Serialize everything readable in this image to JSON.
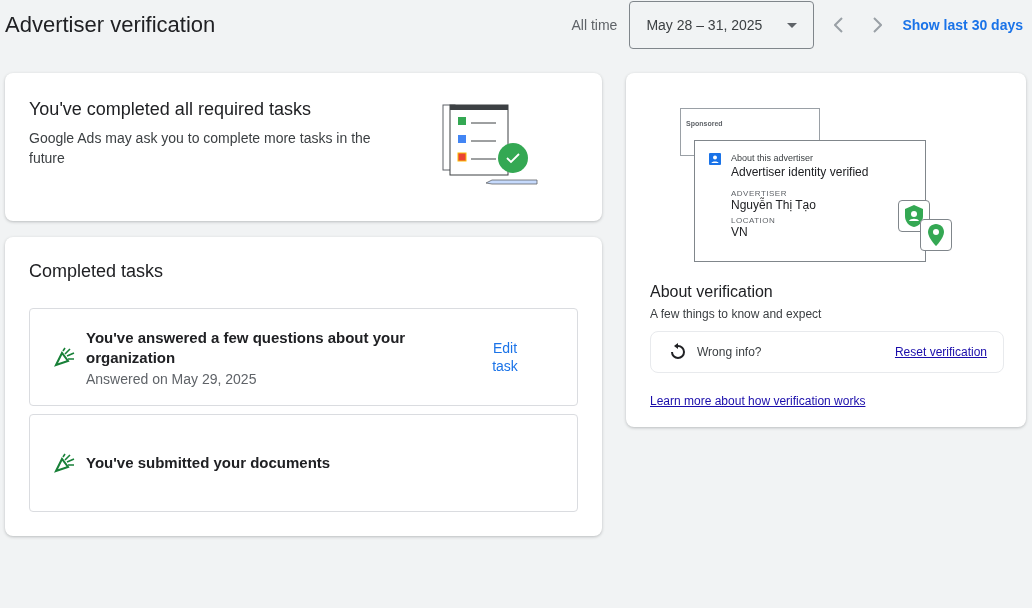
{
  "header": {
    "title": "Advertiser verification",
    "range_label": "All time",
    "date_range": "May 28 – 31, 2025",
    "show_last": "Show last 30 days"
  },
  "status_card": {
    "title": "You've completed all required tasks",
    "description": "Google Ads may ask you to complete more tasks in the future"
  },
  "completed_tasks": {
    "title": "Completed tasks",
    "tasks": [
      {
        "title": "You've answered a few questions about your organization",
        "subtitle": "Answered on May 29, 2025",
        "action": "Edit task"
      },
      {
        "title": "You've submitted your documents"
      }
    ]
  },
  "verification_preview": {
    "sponsored_label": "Sponsored",
    "heading": "About this advertiser",
    "status": "Advertiser identity verified",
    "fields": [
      {
        "label": "ADVERTISER",
        "value": "Nguyễn Thị Tạo"
      },
      {
        "label": "LOCATION",
        "value": "VN"
      }
    ]
  },
  "about": {
    "title": "About verification",
    "subtitle": "A few things to know and expect",
    "wrong_info": "Wrong info?",
    "reset_link": "Reset verification",
    "learn_more": "Learn more about how verification works"
  }
}
